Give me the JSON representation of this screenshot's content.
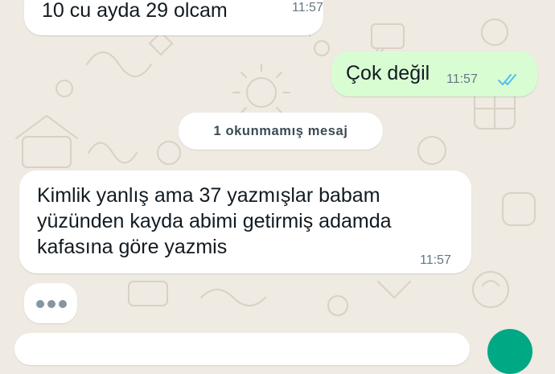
{
  "theme": {
    "accent": "#00a884",
    "tick_color": "#53bdeb"
  },
  "messages": [
    {
      "direction": "incoming",
      "text": "10 cu ayda 29 olcam",
      "time": "11:57"
    },
    {
      "direction": "outgoing",
      "text": "Çok değil",
      "time": "11:57",
      "status_icon": "double-check-read-icon"
    },
    {
      "direction": "incoming",
      "lines": [
        "Kimlik yanlış ama 37 yazmışlar babam",
        "yüzünden kayda abimi getirmiş adamda",
        "kafasına göre yazmis"
      ],
      "time": "11:57"
    }
  ],
  "unread_divider": {
    "label": "1 okunmamış mesaj"
  },
  "typing_indicator": {
    "icon": "typing-dots-icon"
  }
}
